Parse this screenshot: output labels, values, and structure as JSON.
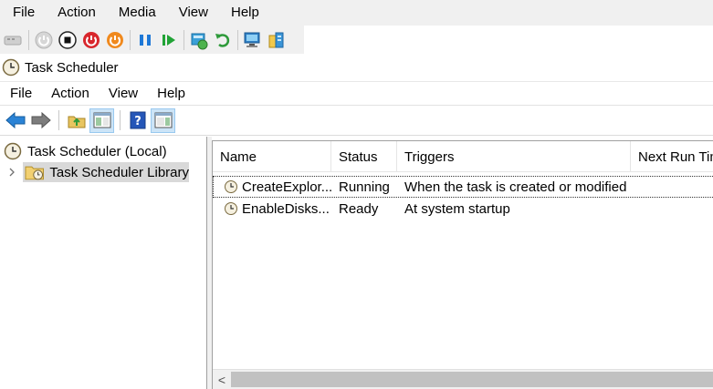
{
  "host_menubar": {
    "items": [
      "File",
      "Action",
      "Media",
      "View",
      "Help"
    ]
  },
  "host_toolbar": {
    "buttons": [
      "ctrl-alt-del-icon",
      "start-icon",
      "turn-off-icon",
      "shutdown-icon",
      "save-icon",
      "pause-icon",
      "reset-icon",
      "checkpoint-icon",
      "revert-icon",
      "enhanced-session-icon",
      "share-icon"
    ]
  },
  "window": {
    "title": "Task Scheduler"
  },
  "mmc_menubar": {
    "items": [
      "File",
      "Action",
      "View",
      "Help"
    ]
  },
  "mmc_toolbar": {
    "buttons": [
      "back-icon",
      "forward-icon",
      "up-folder-icon",
      "show-hide-console-tree-icon",
      "help-icon",
      "show-hide-action-pane-icon"
    ]
  },
  "tree": {
    "root": "Task Scheduler (Local)",
    "child": "Task Scheduler Library"
  },
  "list": {
    "columns": [
      "Name",
      "Status",
      "Triggers",
      "Next Run Time"
    ],
    "rows": [
      {
        "name": "CreateExplor...",
        "status": "Running",
        "triggers": "When the task is created or modified"
      },
      {
        "name": "EnableDisks...",
        "status": "Ready",
        "triggers": "At system startup"
      }
    ]
  },
  "scrollbar": {
    "left_arrow": "<"
  },
  "colors": {
    "accent_blue": "#1e78d7",
    "stop_red": "#d8262c",
    "save_orange": "#f0891d",
    "play_green": "#21a336",
    "selection_gray": "#d9d9d9",
    "toolbar_active": "#cce4f7"
  }
}
